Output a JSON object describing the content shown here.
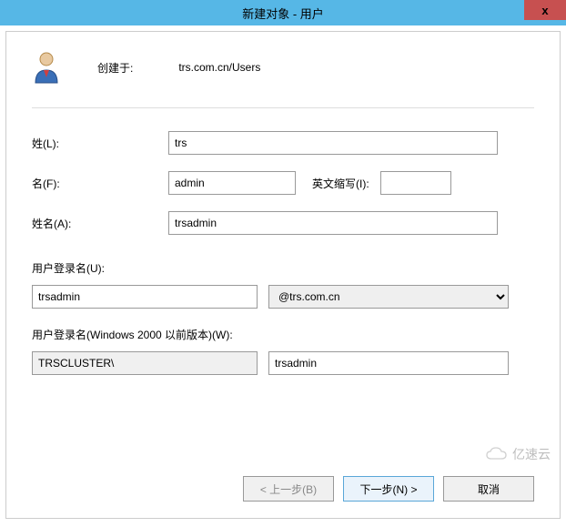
{
  "titlebar": {
    "title": "新建对象 - 用户",
    "close": "x"
  },
  "header": {
    "created_label": "创建于:",
    "created_path": "trs.com.cn/Users"
  },
  "fields": {
    "lastname_label": "姓(L):",
    "lastname_value": "trs",
    "firstname_label": "名(F):",
    "firstname_value": "admin",
    "initials_label": "英文缩写(I):",
    "initials_value": "",
    "fullname_label": "姓名(A):",
    "fullname_value": "trsadmin",
    "logon_label": "用户登录名(U):",
    "logon_value": "trsadmin",
    "domain_value": "@trs.com.cn",
    "pre2k_label": "用户登录名(Windows 2000 以前版本)(W):",
    "pre2k_domain": "TRSCLUSTER\\",
    "pre2k_user": "trsadmin"
  },
  "buttons": {
    "back": "< 上一步(B)",
    "next": "下一步(N) >",
    "cancel": "取消"
  },
  "watermark": "亿速云"
}
